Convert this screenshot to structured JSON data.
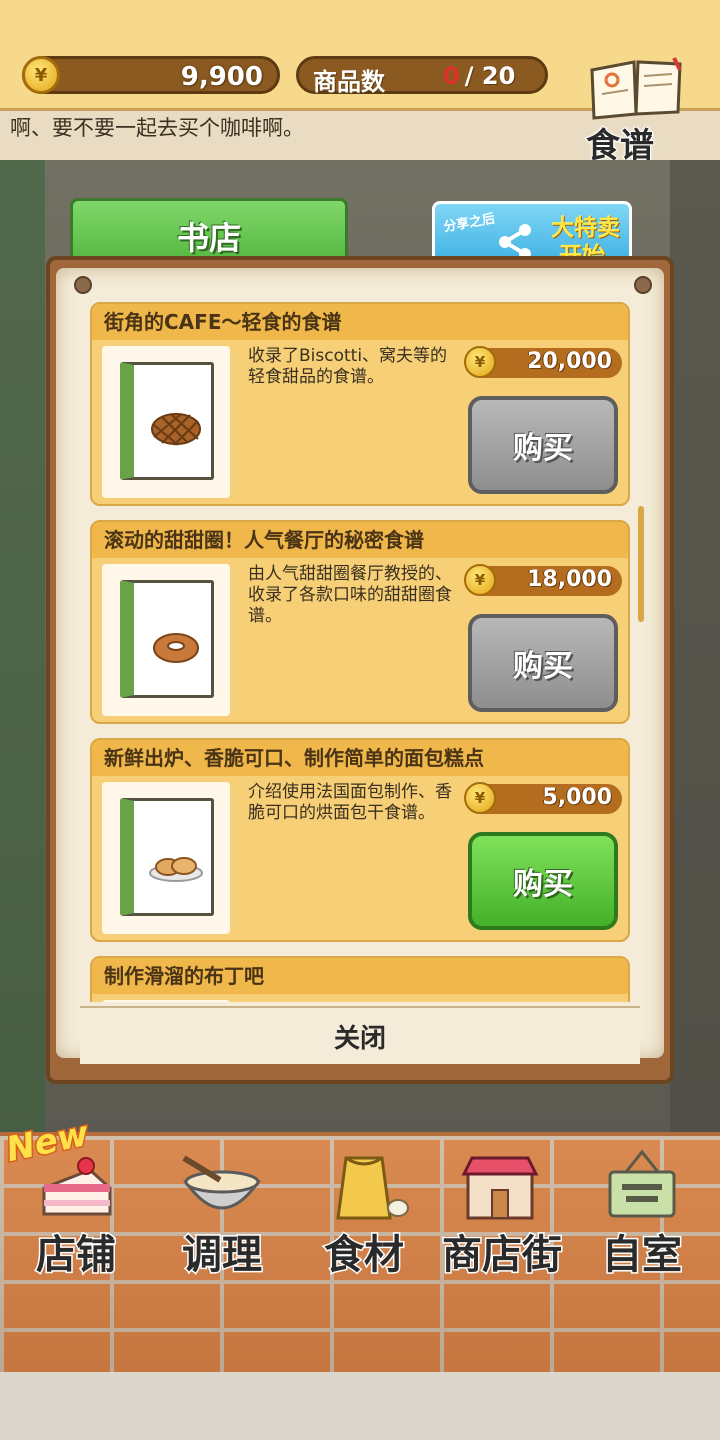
{
  "header": {
    "money": "9,900",
    "product_count_label": "商品数",
    "product_count_current": "0",
    "product_count_total": "/ 20",
    "currency_symbol": "¥",
    "recipe_button_label": "食谱",
    "marquee_text": "啊、要不要一起去买个咖啡啊。"
  },
  "shop": {
    "tab_label": "书店",
    "share_banner": {
      "sub": "分享之后",
      "line1": "大特卖",
      "line2": "开始"
    },
    "items": [
      {
        "title": "街角的CAFE～轻食的食谱",
        "description": "收录了Biscotti、窝夫等的轻食甜品的食谱。",
        "price": "20,000",
        "buy_label": "购买",
        "food_icon": "waffle-icon",
        "affordable": false
      },
      {
        "title": "滚动的甜甜圈！人气餐厅的秘密食谱",
        "description": "由人气甜甜圈餐厅教授的、收录了各款口味的甜甜圈食谱。",
        "price": "18,000",
        "buy_label": "购买",
        "food_icon": "donut-icon",
        "affordable": false
      },
      {
        "title": "新鲜出炉、香脆可口、制作简单的面包糕点",
        "description": "介绍使用法国面包制作、香脆可口的烘面包干食谱。",
        "price": "5,000",
        "buy_label": "购买",
        "food_icon": "bread-icon",
        "affordable": true
      },
      {
        "title": "制作滑溜的布丁吧"
      }
    ],
    "close_label": "关闭"
  },
  "nav": {
    "new_badge": "New",
    "items": [
      {
        "label": "店铺",
        "icon": "cake-icon"
      },
      {
        "label": "调理",
        "icon": "mixing-bowl-icon"
      },
      {
        "label": "食材",
        "icon": "flour-sack-icon"
      },
      {
        "label": "商店街",
        "icon": "shop-icon"
      },
      {
        "label": "自室",
        "icon": "staff-door-icon"
      }
    ]
  },
  "colors": {
    "buy_enabled": "#45b02a",
    "buy_disabled": "#8e8e8e",
    "card_bg": "#f6cf76",
    "price_pill": "#b46d1e"
  }
}
